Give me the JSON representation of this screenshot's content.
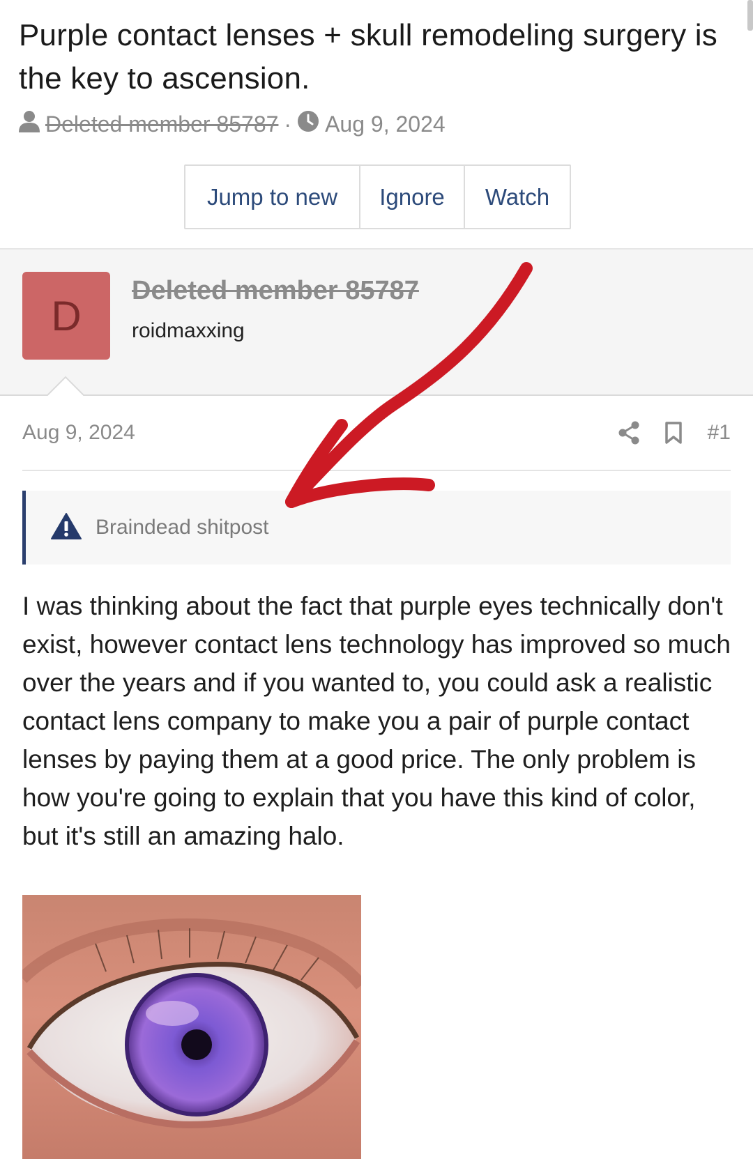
{
  "thread": {
    "title": "Purple contact lenses + skull remodeling surgery is the key to ascension.",
    "author": "Deleted member 85787",
    "separator": "·",
    "date": "Aug 9, 2024"
  },
  "actions": {
    "jump_to_new": "Jump to new",
    "ignore": "Ignore",
    "watch": "Watch"
  },
  "user": {
    "avatar_letter": "D",
    "name": "Deleted member 85787",
    "title": "roidmaxxing"
  },
  "post": {
    "date": "Aug 9, 2024",
    "number": "#1",
    "warning": "Braindead shitpost",
    "body": "I was thinking about the fact that purple eyes technically don't exist, however contact lens technology has improved so much over the years and if you wanted to, you could ask a realistic contact lens company to make you a pair of purple contact lenses by paying them at a good price. The only problem is how you're going to explain that you have this kind of color, but it's still an amazing halo."
  },
  "icons": {
    "author": "user-icon",
    "date": "clock-icon",
    "share": "share-icon",
    "bookmark": "bookmark-icon",
    "warning": "warning-icon"
  },
  "colors": {
    "link": "#2c4a7a",
    "avatar_bg": "#cc6666",
    "warning_border": "#2b3f6e",
    "annotation_arrow": "#cc1a24"
  }
}
